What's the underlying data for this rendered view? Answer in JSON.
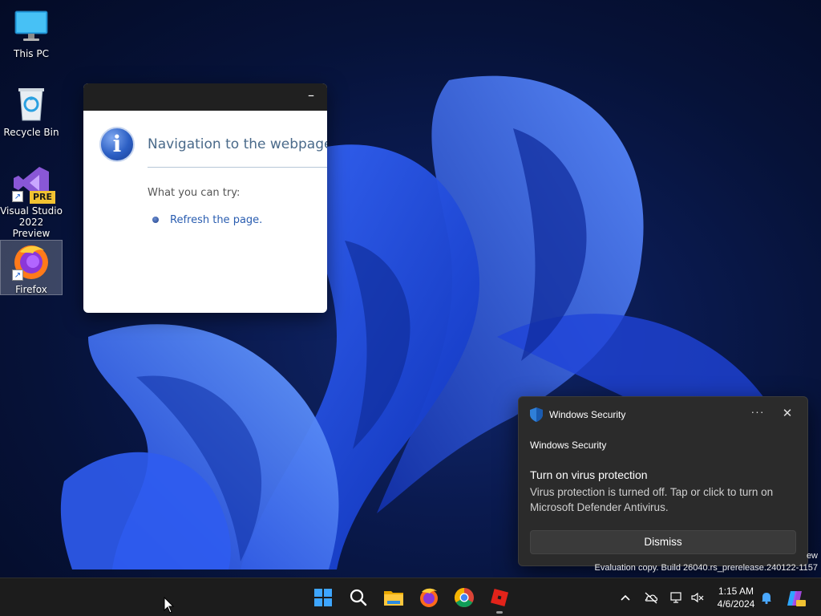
{
  "desktop": {
    "icons": [
      {
        "label": "This PC",
        "icon": "monitor-icon"
      },
      {
        "label": "Recycle Bin",
        "icon": "recycle-bin-icon"
      },
      {
        "label": "Visual Studio 2022 Preview",
        "icon": "visual-studio-icon",
        "badge": "PRE"
      },
      {
        "label": "Firefox",
        "icon": "firefox-icon"
      }
    ]
  },
  "dialog": {
    "heading": "Navigation to the webpage w",
    "try_label": "What you can try:",
    "refresh_link": "Refresh the page.",
    "minimize": "–",
    "info_glyph": "i"
  },
  "toast": {
    "app_name": "Windows Security",
    "more": "···",
    "close": "✕",
    "subtitle": "Windows Security",
    "title": "Turn on virus protection",
    "message": "Virus protection is turned off. Tap or click to turn on Microsoft Defender Antivirus.",
    "dismiss_label": "Dismiss"
  },
  "watermark": {
    "line1": "ew",
    "line2": "Evaluation copy. Build 26040.rs_prerelease.240122-1157"
  },
  "taskbar": {
    "apps": [
      "start-icon",
      "search-icon",
      "file-explorer-icon",
      "firefox-icon",
      "chrome-icon",
      "roblox-icon"
    ],
    "tray": [
      "chevron-up-icon",
      "onedrive-icon",
      "network-icon",
      "volume-muted-icon",
      "notification-bell-icon",
      "copilot-icon"
    ],
    "time": "1:15 AM",
    "date": "4/6/2024"
  },
  "colors": {
    "accent": "#0067c0",
    "toast_bg": "#2b2b2b",
    "taskbar_bg": "#1c1c1c"
  }
}
